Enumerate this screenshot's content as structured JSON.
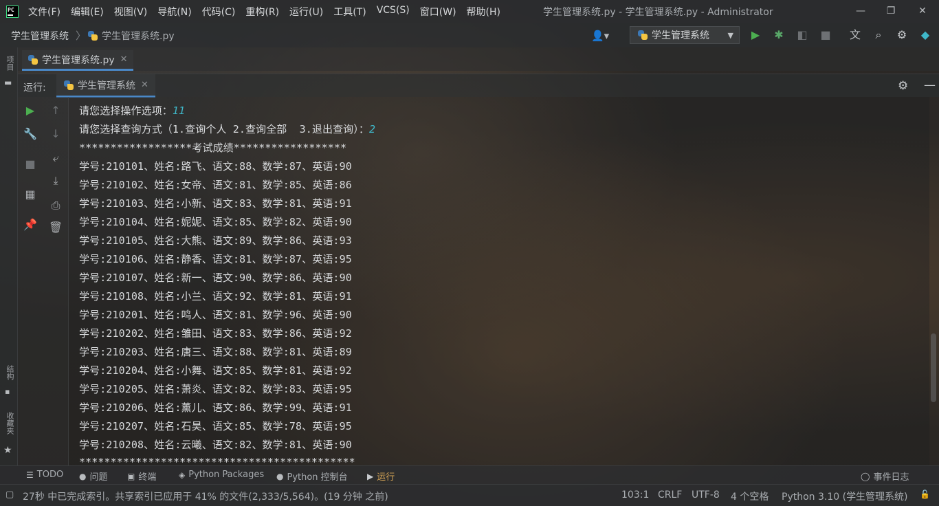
{
  "titlebar": {
    "logo_text": "PC",
    "menu": [
      "文件(F)",
      "编辑(E)",
      "视图(V)",
      "导航(N)",
      "代码(C)",
      "重构(R)",
      "运行(U)",
      "工具(T)",
      "VCS(S)",
      "窗口(W)",
      "帮助(H)"
    ],
    "window_title": "学生管理系统.py - 学生管理系统.py - Administrator",
    "minimize": "—",
    "maximize": "❐",
    "close": "✕"
  },
  "navbar": {
    "project": "学生管理系统",
    "separator": "〉",
    "file": "学生管理系统.py",
    "run_config": "学生管理系统"
  },
  "left_stripe": {
    "project_label": "项目",
    "structure_label": "结构",
    "bookmarks_label": "收藏夹"
  },
  "editor_tab": {
    "label": "学生管理系统.py"
  },
  "run_panel": {
    "label": "运行:",
    "tab": "学生管理系统"
  },
  "console": {
    "prompt1": "请您选择操作选项：",
    "input1": "11",
    "prompt2": "请您选择查询方式（1.查询个人 2.查询全部  3.退出查询）：",
    "input2": "2",
    "header": "******************考试成绩******************",
    "rows": [
      "学号:210101、姓名:路飞、语文:88、数学:87、英语:90",
      "学号:210102、姓名:女帝、语文:81、数学:85、英语:86",
      "学号:210103、姓名:小新、语文:83、数学:81、英语:91",
      "学号:210104、姓名:妮妮、语文:85、数学:82、英语:90",
      "学号:210105、姓名:大熊、语文:89、数学:86、英语:93",
      "学号:210106、姓名:静香、语文:81、数学:87、英语:95",
      "学号:210107、姓名:新一、语文:90、数学:86、英语:90",
      "学号:210108、姓名:小兰、语文:92、数学:81、英语:91",
      "学号:210201、姓名:鸣人、语文:81、数学:96、英语:90",
      "学号:210202、姓名:雏田、语文:83、数学:86、英语:92",
      "学号:210203、姓名:唐三、语文:88、数学:81、英语:89",
      "学号:210204、姓名:小舞、语文:85、数学:81、英语:92",
      "学号:210205、姓名:萧炎、语文:82、数学:83、英语:95",
      "学号:210206、姓名:薰儿、语文:86、数学:99、英语:91",
      "学号:210207、姓名:石昊、语文:85、数学:78、英语:95",
      "学号:210208、姓名:云曦、语文:82、数学:81、英语:90"
    ],
    "footer": "********************************************"
  },
  "tool_tabs": {
    "todo": "TODO",
    "problems": "问题",
    "terminal": "终端",
    "python_packages": "Python Packages",
    "python_console": "Python 控制台",
    "run": "运行",
    "event_log": "事件日志"
  },
  "statusbar": {
    "message": "27秒 中已完成索引。共享索引已应用于 41% 的文件(2,333/5,564)。(19 分钟 之前)",
    "position": "103:1",
    "line_separator": "CRLF",
    "encoding": "UTF-8",
    "indent": "4 个空格",
    "interpreter": "Python 3.10 (学生管理系统)"
  }
}
